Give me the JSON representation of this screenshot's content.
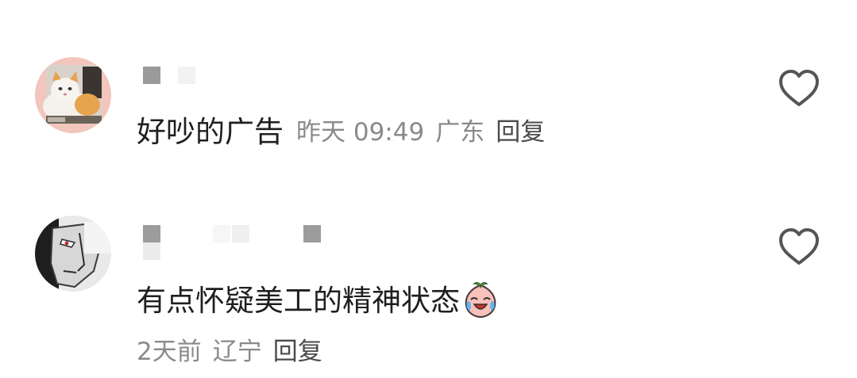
{
  "comments": [
    {
      "text": "好吵的广告",
      "time": "昨天 09:49",
      "location": "广东",
      "reply_label": "回复"
    },
    {
      "text": "有点怀疑美工的精神状态",
      "emoji_icon": "crying-laughing-peach-emoji",
      "time": "2天前",
      "location": "辽宁",
      "reply_label": "回复"
    }
  ],
  "icons": {
    "like": "heart-outline-icon"
  },
  "colors": {
    "text": "#1f1f1f",
    "meta": "#8a8a8a",
    "reply": "#4a4a4a",
    "heart": "#555555"
  }
}
